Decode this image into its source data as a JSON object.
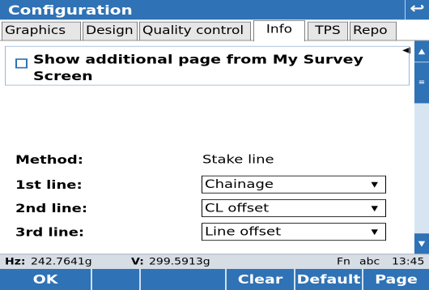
{
  "window": {
    "title": "Configuration",
    "back_icon": "back-arrow-icon"
  },
  "tabs": [
    {
      "label": "Graphics",
      "active": false
    },
    {
      "label": "Design",
      "active": false
    },
    {
      "label": "Quality control",
      "active": false
    },
    {
      "label": "Info",
      "active": true
    },
    {
      "label": "TPS",
      "active": false
    },
    {
      "label": "Repo",
      "active": false
    }
  ],
  "tab_scroll": {
    "left": "◀",
    "right": "▶"
  },
  "option": {
    "checked": false,
    "label": "Show additional page from My Survey Screen"
  },
  "form": {
    "method_label": "Method:",
    "method_value": "Stake line",
    "line1_label": "1st line:",
    "line1_value": "Chainage",
    "line2_label": "2nd line:",
    "line2_value": "CL offset",
    "line3_label": "3rd line:",
    "line3_value": "Line offset"
  },
  "status": {
    "hz_label": "Hz:",
    "hz_value": "242.7641g",
    "v_label": "V:",
    "v_value": "299.5913g",
    "fn": "Fn",
    "input_mode": "abc",
    "time": "13:45"
  },
  "function_keys": [
    "OK",
    "",
    "",
    "Clear",
    "Default",
    "Page"
  ],
  "colors": {
    "accent": "#2f72b5",
    "status_bg": "#d6dde5"
  }
}
